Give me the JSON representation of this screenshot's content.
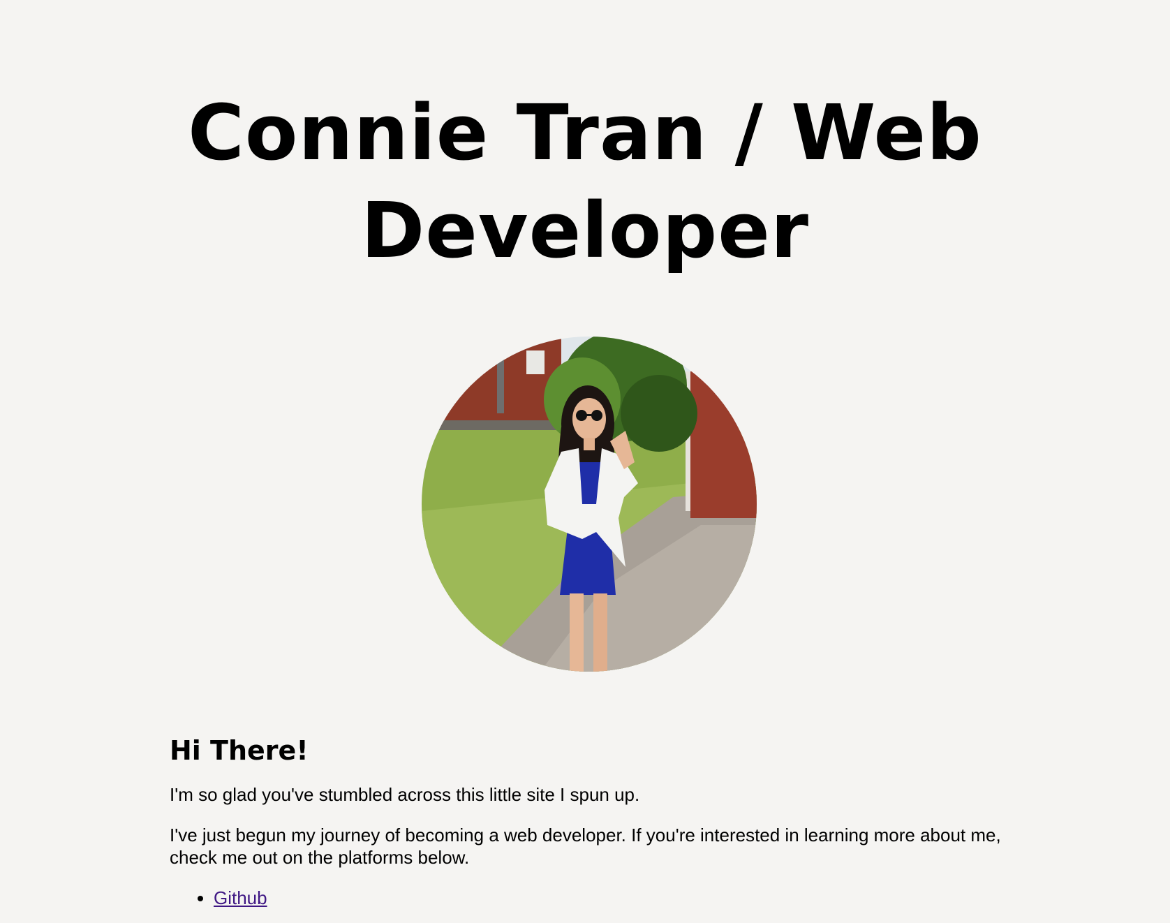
{
  "header": {
    "title_line1": "Connie Tran / Web",
    "title_line2": "Developer"
  },
  "profile": {
    "image_description": "avatar-photo"
  },
  "intro": {
    "heading": "Hi There!",
    "paragraph1": "I'm so glad you've stumbled across this little site I spun up.",
    "paragraph2": "I've just begun my journey of becoming a web developer. If you're interested in learning more about me, check me out on the platforms below."
  },
  "links": [
    {
      "label": "Github"
    }
  ],
  "colors": {
    "background": "#f5f4f2",
    "text": "#000000",
    "link": "#3f1784"
  }
}
